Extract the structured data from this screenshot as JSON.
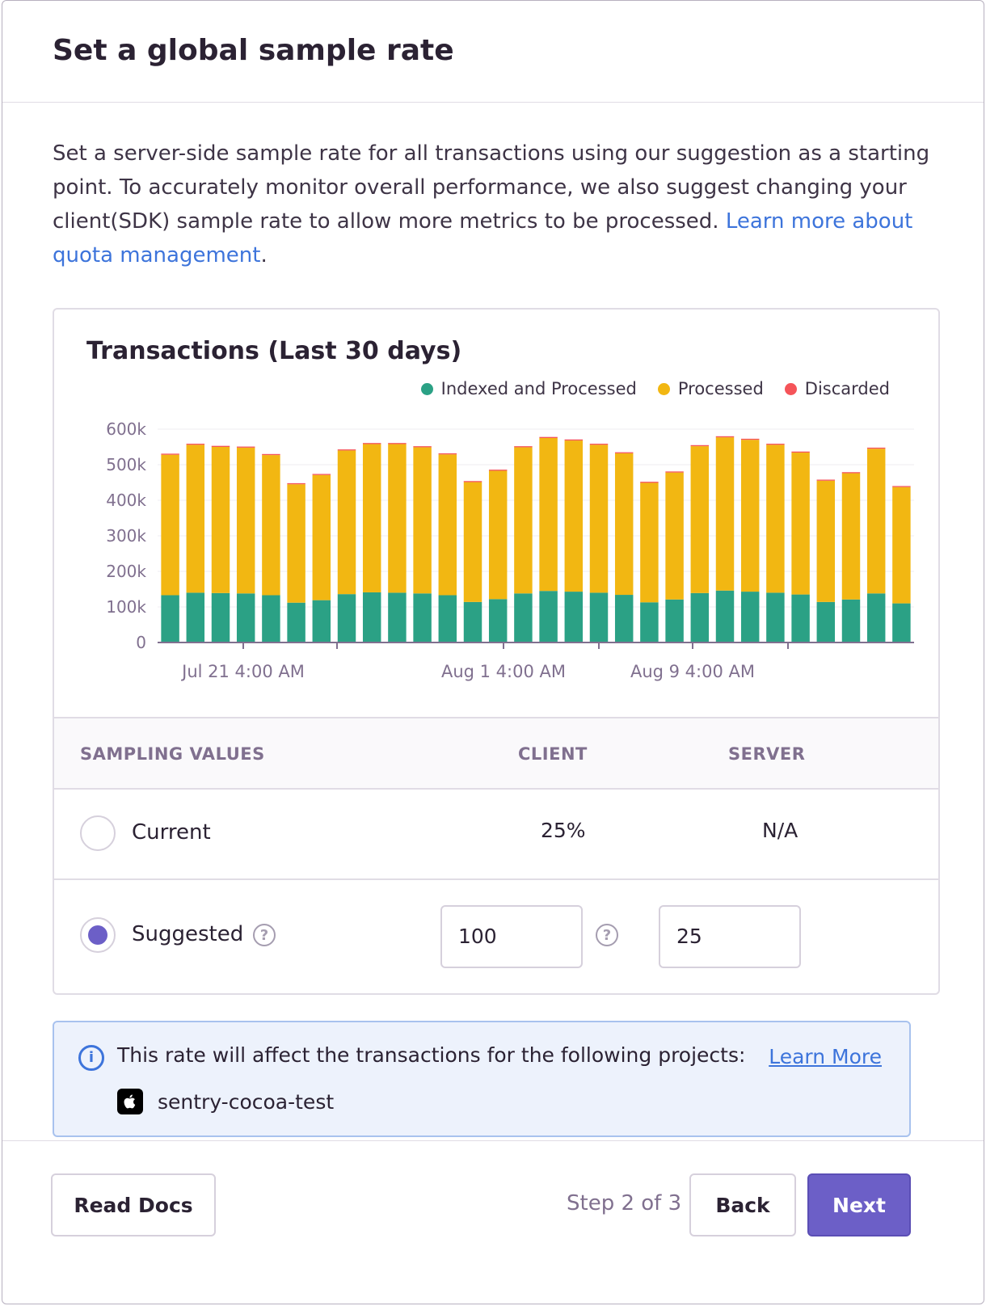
{
  "modal": {
    "title": "Set a global sample rate",
    "description_text": "Set a server-side sample rate for all transactions using our suggestion as a starting point. To accurately monitor overall performance, we also suggest changing your client(SDK) sample rate to allow more metrics to be processed. ",
    "description_link": "Learn more about quota management",
    "description_end": "."
  },
  "chart_data": {
    "type": "bar",
    "stacked": true,
    "title": "Transactions (Last 30 days)",
    "xlabel": "",
    "ylabel": "",
    "ylim": [
      0,
      600000
    ],
    "y_ticks": [
      "0",
      "100k",
      "200k",
      "300k",
      "400k",
      "500k",
      "600k"
    ],
    "x_tick_labels": [
      "Jul 21 4:00 AM",
      "Aug 1 4:00 AM",
      "Aug 9 4:00 AM"
    ],
    "categories": [
      "1",
      "2",
      "3",
      "4",
      "5",
      "6",
      "7",
      "8",
      "9",
      "10",
      "11",
      "12",
      "13",
      "14",
      "15",
      "16",
      "17",
      "18",
      "19",
      "20",
      "21",
      "22",
      "23",
      "24",
      "25",
      "26",
      "27",
      "28",
      "29",
      "30"
    ],
    "series": [
      {
        "name": "Indexed and Processed",
        "color": "#2ba185",
        "values": [
          133000,
          140000,
          139000,
          138000,
          133000,
          112000,
          119000,
          136000,
          141000,
          140000,
          138000,
          133000,
          114000,
          122000,
          138000,
          145000,
          143000,
          140000,
          134000,
          113000,
          121000,
          139000,
          146000,
          143000,
          140000,
          135000,
          114000,
          121000,
          138000,
          110000
        ]
      },
      {
        "name": "Processed",
        "color": "#f2b712",
        "values": [
          395000,
          416000,
          411000,
          410000,
          394000,
          333000,
          352000,
          404000,
          417000,
          418000,
          411000,
          396000,
          337000,
          361000,
          411000,
          430000,
          425000,
          416000,
          398000,
          336000,
          357000,
          413000,
          431000,
          427000,
          416000,
          399000,
          341000,
          355000,
          407000,
          327000
        ]
      },
      {
        "name": "Discarded",
        "color": "#f55459",
        "values": [
          3000,
          3000,
          3000,
          3000,
          3000,
          3000,
          3000,
          3000,
          3000,
          3000,
          3000,
          3000,
          3000,
          3000,
          3000,
          3000,
          3000,
          3000,
          3000,
          3000,
          3000,
          3000,
          3000,
          3000,
          3000,
          3000,
          3000,
          3000,
          3000,
          3000
        ]
      }
    ]
  },
  "table": {
    "headers": [
      "SAMPLING VALUES",
      "CLIENT",
      "SERVER"
    ],
    "current": {
      "label": "Current",
      "client": "25%",
      "server": "N/A"
    },
    "suggested": {
      "label": "Suggested",
      "client_value": "100",
      "server_value": "25"
    }
  },
  "alert": {
    "text": "This rate will affect the transactions for the following projects:",
    "link": "Learn More",
    "project": "sentry-cocoa-test"
  },
  "footer": {
    "read_docs": "Read Docs",
    "step": "Step 2 of 3",
    "back": "Back",
    "next": "Next"
  },
  "icons": {
    "help": "question-circle-icon",
    "info": "info-circle-icon",
    "platform": "apple-icon"
  }
}
